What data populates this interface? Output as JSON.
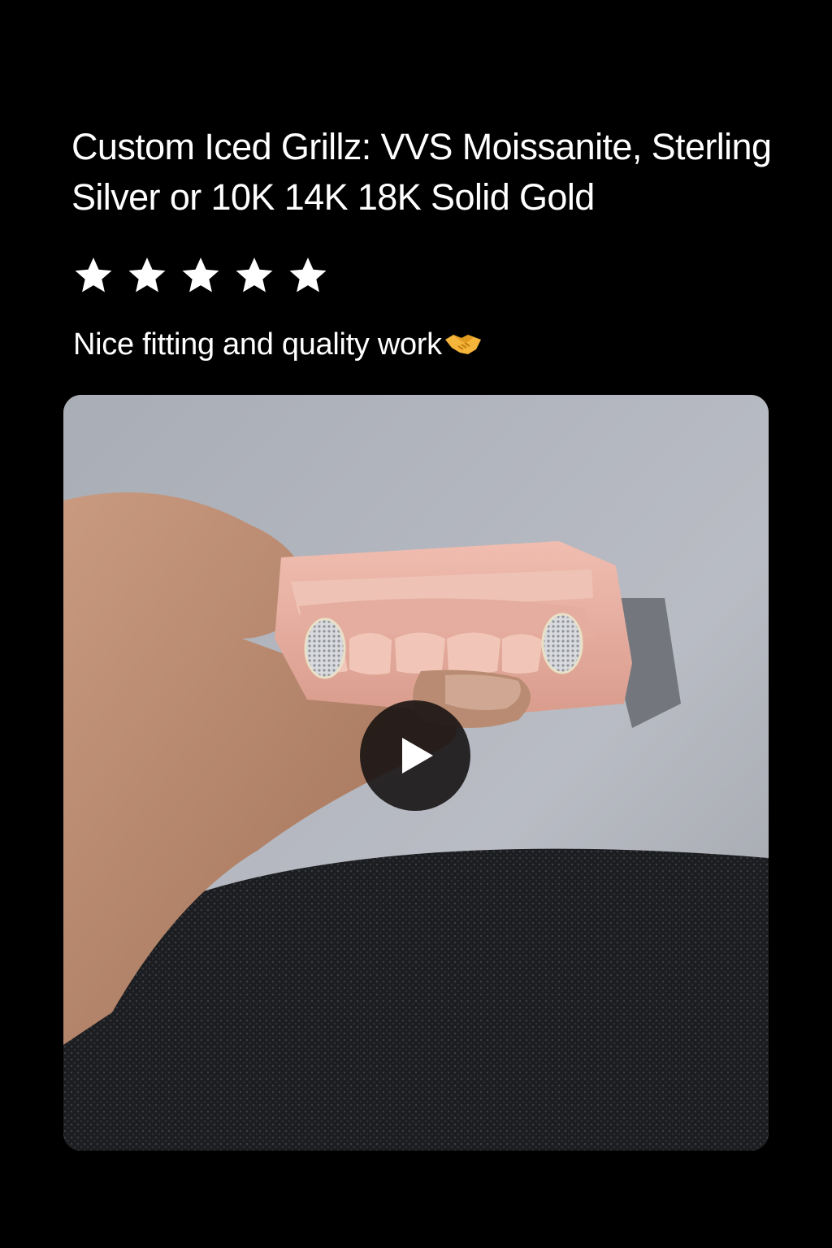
{
  "review": {
    "product_title": "Custom Iced Grillz: VVS Moissanite, Sterling Silver or 10K 14K 18K Solid Gold",
    "rating": 5,
    "rating_max": 5,
    "text": "Nice fitting and quality work",
    "text_emoji": "handshake-emoji"
  },
  "media": {
    "type": "video",
    "play_icon": "play-icon"
  },
  "colors": {
    "background": "#000000",
    "text": "#ffffff",
    "star": "#ffffff",
    "play_button_bg": "#141010"
  }
}
